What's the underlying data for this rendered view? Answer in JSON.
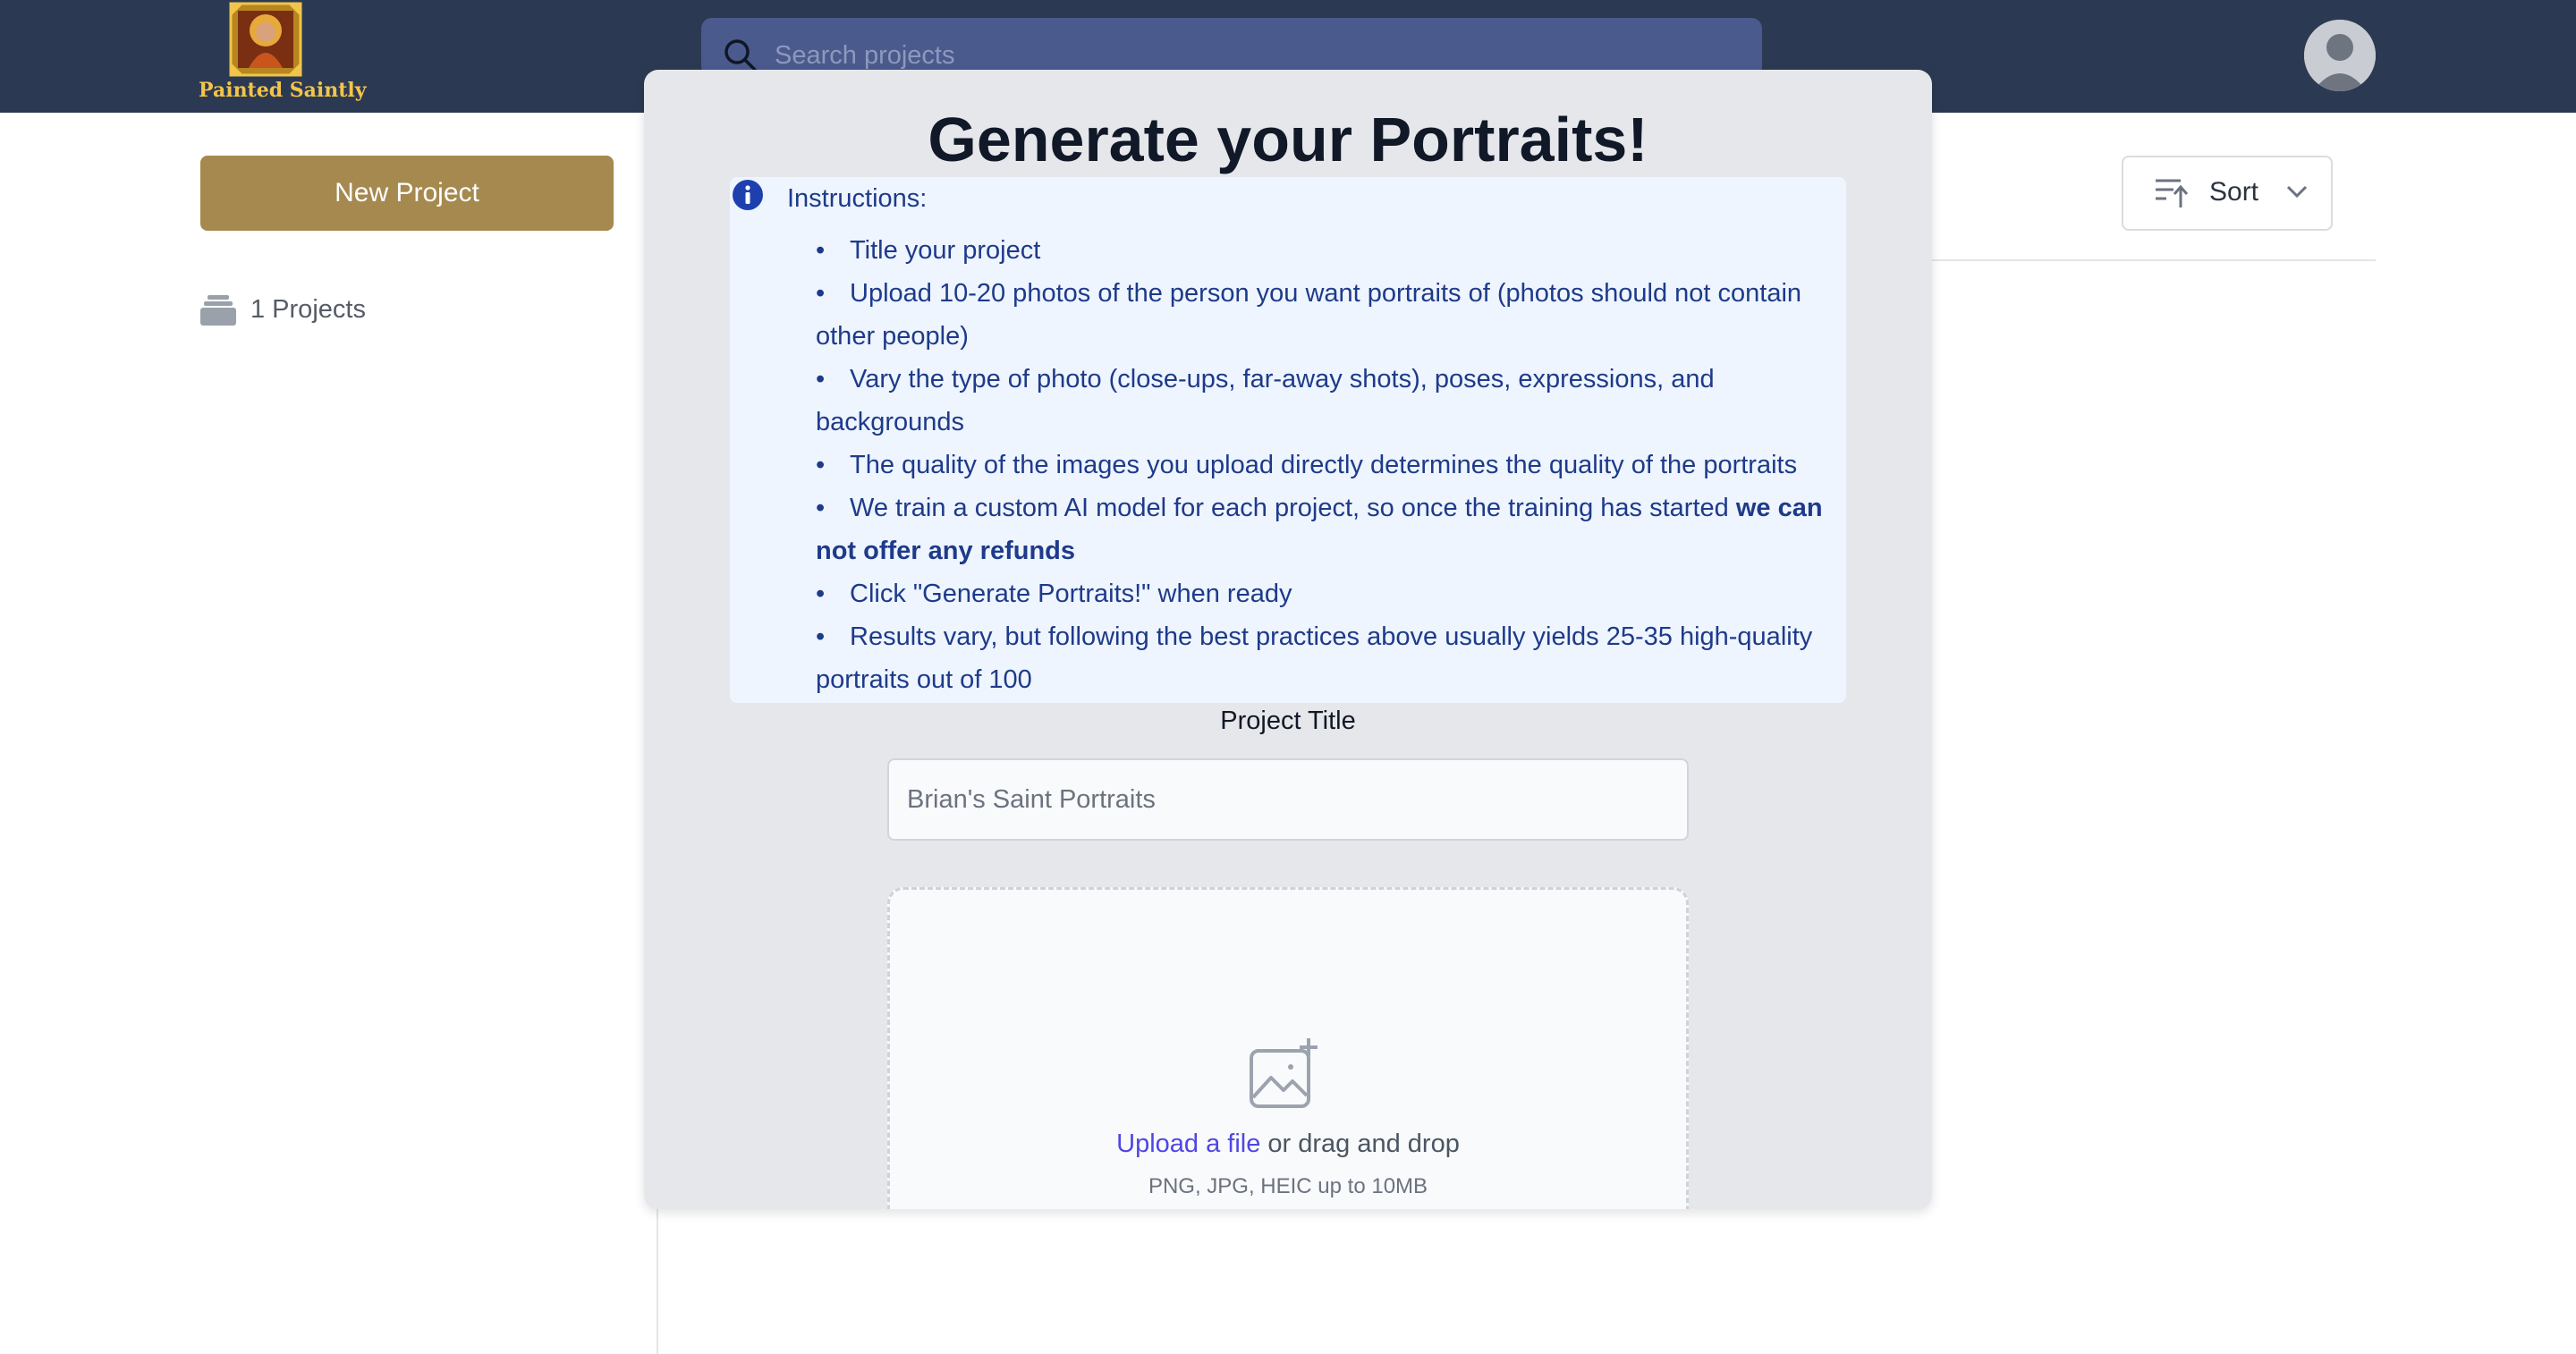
{
  "app": {
    "brand": "Painted Saintly"
  },
  "header": {
    "search_placeholder": "Search projects"
  },
  "sidebar": {
    "new_project_label": "New Project",
    "projects_count_label": "1 Projects"
  },
  "main": {
    "sort_label": "Sort"
  },
  "modal": {
    "title": "Generate your Portraits!",
    "instructions_heading": "Instructions:",
    "instructions": [
      "Title your project",
      "Upload 10-20 photos of the person you want portraits of (photos should not contain other people)",
      "Vary the type of photo (close-ups, far-away shots), poses, expressions, and backgrounds",
      "The quality of the images you upload directly determines the quality of the portraits",
      "We train a custom AI model for each project, so once the training has started",
      "Click \"Generate Portraits!\" when ready",
      "Results vary, but following the best practices above usually yields 25-35 high-quality portraits out of 100"
    ],
    "instructions_bold_tail": "we can not offer any refunds",
    "project_title_label": "Project Title",
    "project_title_value": "Brian's Saint Portraits",
    "upload_link": "Upload a file",
    "upload_rest": " or drag and drop",
    "upload_hint": "PNG, JPG, HEIC up to 10MB"
  },
  "colors": {
    "navbar": "#2b3a52",
    "accent_gold": "#a5894f",
    "instructions_text": "#1e3a8a",
    "link": "#4f46e5"
  },
  "icons": [
    "saint-logo-icon",
    "search-icon",
    "avatar-icon",
    "projects-stack-icon",
    "sort-icon",
    "chevron-down-icon",
    "info-icon",
    "image-add-icon"
  ]
}
